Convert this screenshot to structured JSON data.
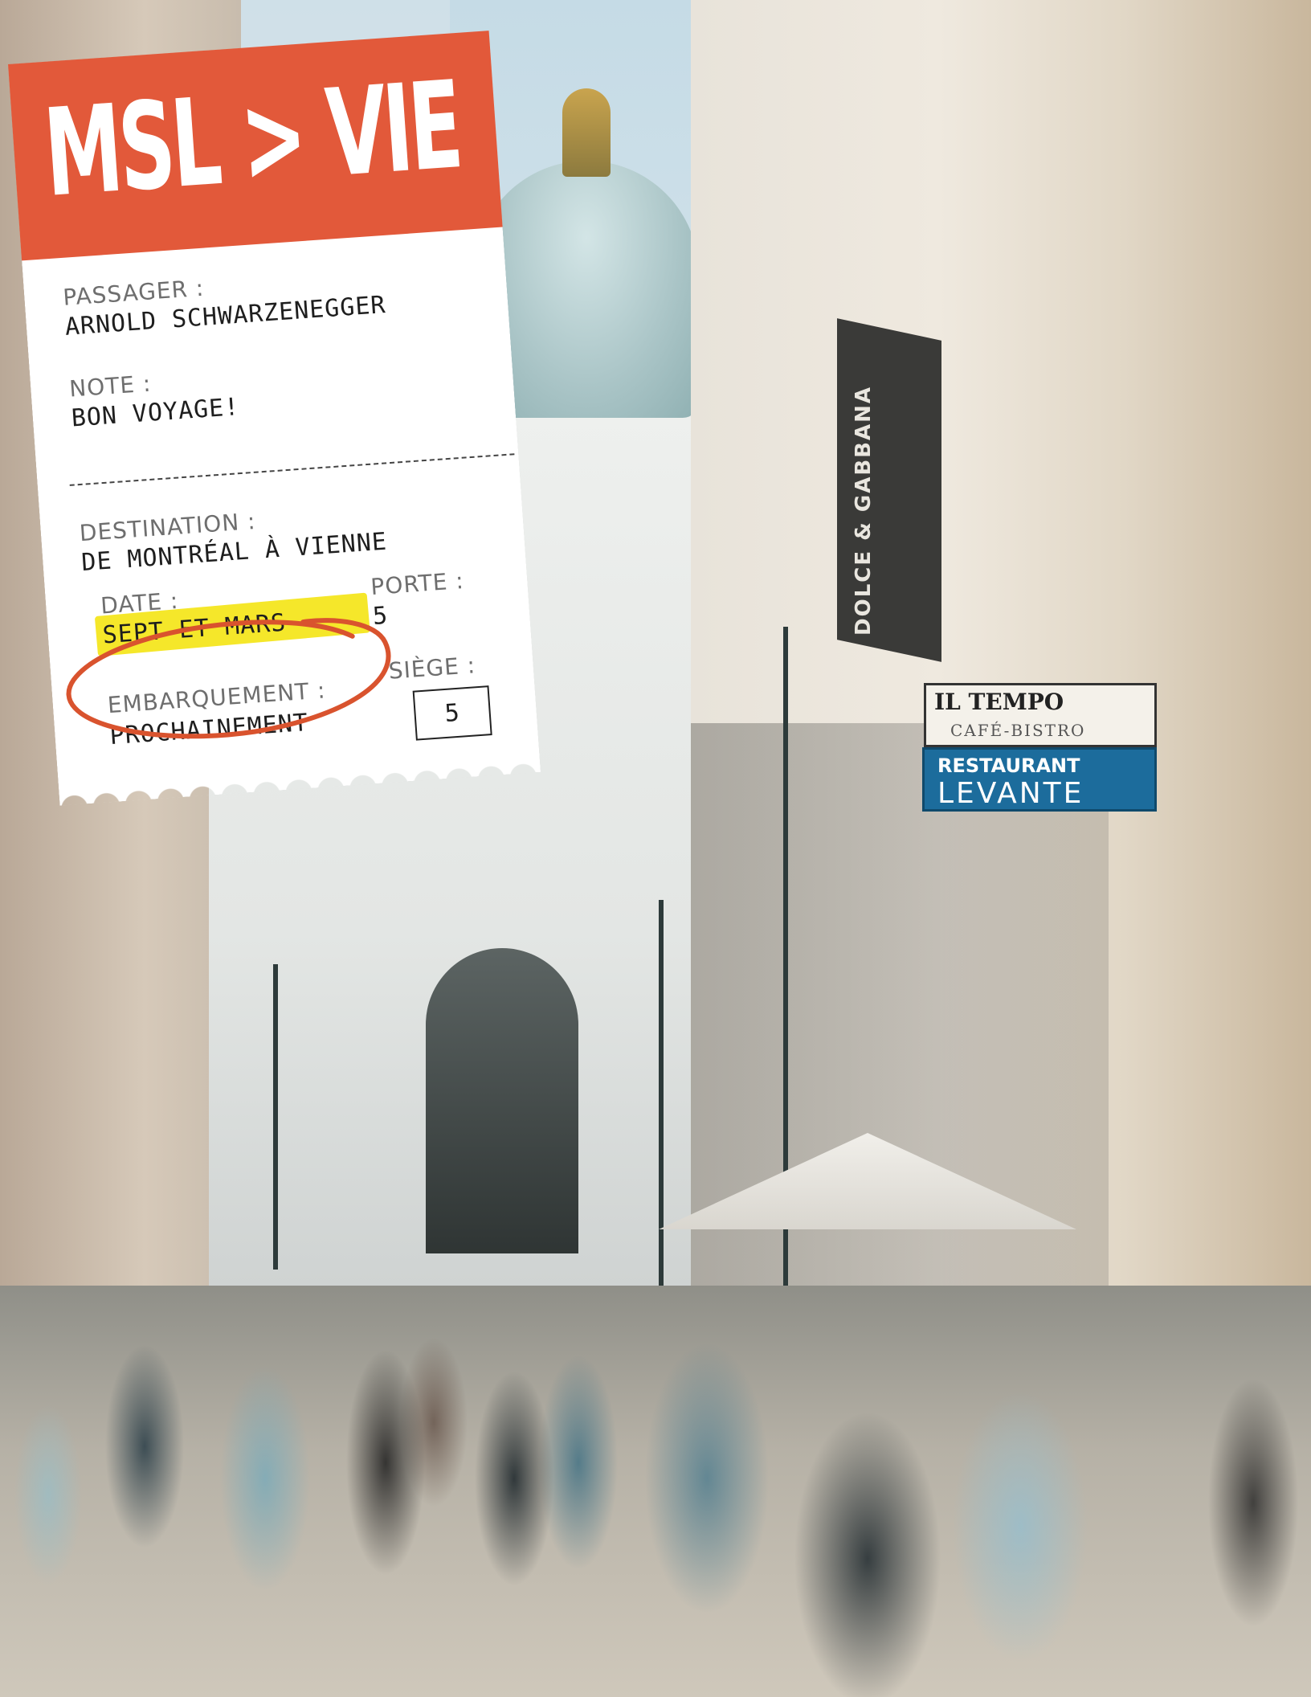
{
  "ticket": {
    "route": "MSL > VIE",
    "passenger_label": "PASSAGER :",
    "passenger_value": "ARNOLD SCHWARZENEGGER",
    "note_label": "NOTE :",
    "note_value": "BON VOYAGE!",
    "destination_label": "DESTINATION :",
    "destination_value": "DE MONTRÉAL À VIENNE",
    "date_label": "DATE :",
    "date_value": "SEPT ET MARS",
    "gate_label": "PORTE :",
    "gate_value": "5",
    "boarding_label": "EMBARQUEMENT :",
    "boarding_value": "PROCHAINEMENT",
    "seat_label": "SIÈGE :",
    "seat_value": "5"
  },
  "colors": {
    "header": "#e2593a",
    "highlight": "#f5e72a",
    "circle": "#d9532e"
  },
  "scene": {
    "banner_text": "DOLCE & GABBANA",
    "sign_tempo_title": "IL TEMPO",
    "sign_tempo_sub": "CAFÉ-BISTRO",
    "sign_levante_top": "RESTAURANT",
    "sign_levante_main": "LEVANTE"
  }
}
